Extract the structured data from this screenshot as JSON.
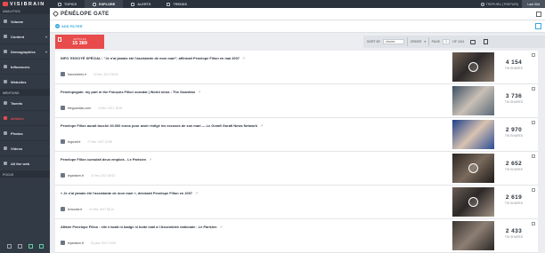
{
  "app": {
    "logo": "VISIBRAIN"
  },
  "topnav": {
    "items": [
      {
        "label": "TOPICS",
        "active": false
      },
      {
        "label": "EXPLORE",
        "active": true
      },
      {
        "label": "ALERTS",
        "active": false
      },
      {
        "label": "TRENDS",
        "active": false
      }
    ],
    "user": "TREPURU (TREPURI)",
    "period": "Last 30d"
  },
  "sidebar": {
    "sections": {
      "analytics": "ANALYTICS",
      "mentions": "MENTIONS",
      "focus": "FOCUS"
    },
    "analytics_items": [
      {
        "label": "Volume"
      },
      {
        "label": "Content",
        "expandable": true
      },
      {
        "label": "Demographics",
        "expandable": true
      },
      {
        "label": "Influencers"
      },
      {
        "label": "Websites"
      }
    ],
    "mention_items": [
      {
        "label": "Tweets",
        "active": false
      },
      {
        "label": "Articles",
        "active": true
      },
      {
        "label": "Photos",
        "active": false
      },
      {
        "label": "Videos",
        "active": false
      },
      {
        "label": "All the web",
        "active": false
      }
    ]
  },
  "header": {
    "title": "PÉNÉLOPE GATE"
  },
  "filter": {
    "add_label": "ADD FILTER"
  },
  "stats": {
    "articles_label": "ARTICLES",
    "articles_value": "15 389"
  },
  "controls": {
    "sort_by": "SORT BY",
    "sort_value": "shares",
    "order": "ORDER",
    "page_label": "PAGE",
    "page_value": "1",
    "page_total": "OF 1011"
  },
  "colors": {
    "accent": "#e84b4b",
    "link": "#37a8dc",
    "sidebar": "#323a45",
    "topbar": "#2b323b"
  },
  "articles": [
    {
      "headline": "INFO 'ENVOYÉ SPÉCIAL'. \"Je n'ai jamais été l'assistante de mon mari\", affirmait Penelope Fillon en mai 2007",
      "site": "francetvinfo.fr",
      "date": "02 févr. 2017 08:00",
      "shares": "4 154",
      "shares_label": "TW SHARES"
    },
    {
      "headline": "Penelopegate: my part in the François Fillon scandal | World news : The Guardian",
      "site": "theguardian.com",
      "date": "10 févr. 2017 18:04",
      "shares": "3 736",
      "shares_label": "TW SHARES"
    },
    {
      "headline": "Penelope Fillon aurait touché 20.000 euros pour avoir rédigé les excuses de son mari — Le Gorafi Gorafi News Network",
      "site": "legorafi.fr",
      "date": "07 févr. 2017 10:58",
      "shares": "2 970",
      "shares_label": "TW SHARES"
    },
    {
      "headline": "Penelope Fillon cumulait deux emplois - Le Parisien",
      "site": "leparisien.fr",
      "date": "07 févr. 2017 08:10",
      "shares": "2 652",
      "shares_label": "TW SHARES"
    },
    {
      "headline": "« Je n'ai jamais été l'assistante de mon mari », déclarait Penelope Fillon en 2007",
      "site": "lemonde.fr",
      "date": "02 févr. 2017 08:14",
      "shares": "2 619",
      "shares_label": "TW SHARES"
    },
    {
      "headline": "Affaire Penelope Fillon : elle n'avait ni badge ni boîte mail à l'Assemblée nationale - Le Parisien",
      "site": "leparisien.fr",
      "date": "01 janv. 2017 13:53",
      "shares": "2 433",
      "shares_label": "TW SHARES"
    }
  ]
}
